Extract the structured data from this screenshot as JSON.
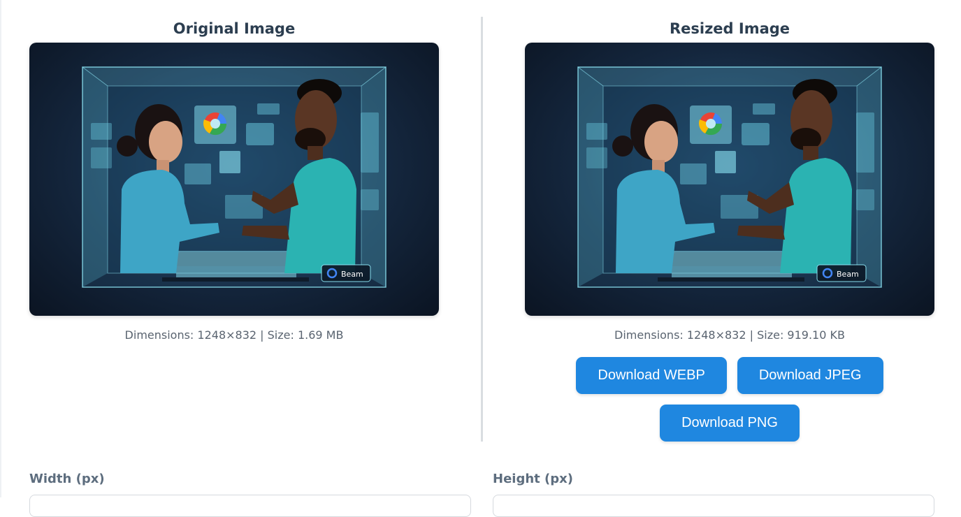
{
  "original": {
    "title": "Original Image",
    "meta": "Dimensions: 1248×832 | Size: 1.69 MB",
    "logo_text": "Beam"
  },
  "resized": {
    "title": "Resized Image",
    "meta": "Dimensions: 1248×832 | Size: 919.10 KB",
    "logo_text": "Beam"
  },
  "buttons": {
    "webp": "Download WEBP",
    "jpeg": "Download JPEG",
    "png": "Download PNG"
  },
  "form": {
    "width_label": "Width (px)",
    "height_label": "Height (px)"
  },
  "colors": {
    "accent": "#1f87e0",
    "heading": "#2c3e50",
    "muted": "#5a6470"
  }
}
